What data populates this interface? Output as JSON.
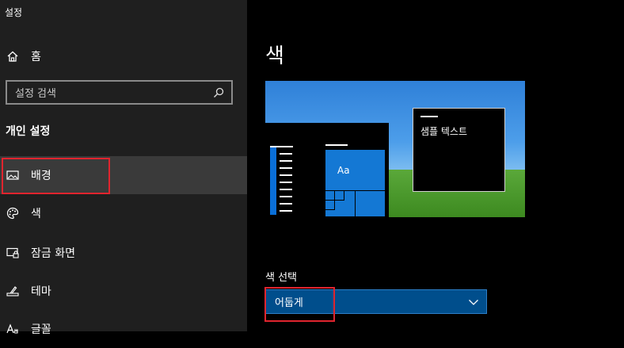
{
  "window": {
    "title": "설정"
  },
  "sidebar": {
    "home_label": "홈",
    "search": {
      "placeholder": "설정 검색"
    },
    "section_title": "개인 설정",
    "items": [
      {
        "label": "배경",
        "icon": "picture-icon",
        "selected": true
      },
      {
        "label": "색",
        "icon": "palette-icon",
        "selected": false
      },
      {
        "label": "잠금 화면",
        "icon": "lock-screen-icon",
        "selected": false
      },
      {
        "label": "테마",
        "icon": "theme-brush-icon",
        "selected": false
      },
      {
        "label": "글꼴",
        "icon": "font-icon",
        "selected": false
      }
    ]
  },
  "main": {
    "page_title": "색",
    "preview": {
      "tile_label": "Aa",
      "sample_text": "샘플 텍스트"
    },
    "color_select": {
      "label": "색 선택",
      "value": "어둡게"
    }
  },
  "colors": {
    "sidebar_bg": "#1f1f1f",
    "selected_bg": "#3a3a3a",
    "accent": "#0078d7",
    "dropdown_bg": "#004e8c",
    "annotation_red": "#e0242e"
  }
}
